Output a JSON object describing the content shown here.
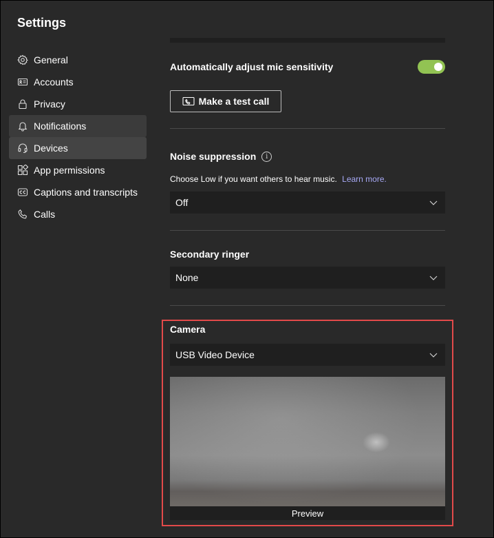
{
  "window": {
    "title": "Settings"
  },
  "sidebar": {
    "items": [
      {
        "label": "General",
        "icon": "gear-icon"
      },
      {
        "label": "Accounts",
        "icon": "id-card-icon"
      },
      {
        "label": "Privacy",
        "icon": "lock-icon"
      },
      {
        "label": "Notifications",
        "icon": "bell-icon",
        "state": "hover"
      },
      {
        "label": "Devices",
        "icon": "headset-icon",
        "state": "selected"
      },
      {
        "label": "App permissions",
        "icon": "apps-icon"
      },
      {
        "label": "Captions and transcripts",
        "icon": "cc-icon"
      },
      {
        "label": "Calls",
        "icon": "phone-icon"
      }
    ]
  },
  "devices": {
    "mic_sensitivity": {
      "label": "Automatically adjust mic sensitivity",
      "enabled": true
    },
    "test_call": {
      "label": "Make a test call"
    },
    "noise_suppression": {
      "label": "Noise suppression",
      "description": "Choose Low if you want others to hear music.",
      "learn_more": "Learn more.",
      "value": "Off"
    },
    "secondary_ringer": {
      "label": "Secondary ringer",
      "value": "None"
    },
    "camera": {
      "label": "Camera",
      "value": "USB Video Device",
      "preview_label": "Preview"
    }
  },
  "colors": {
    "toggle_on": "#92c353",
    "link": "#a7a9f5",
    "highlight_border": "#e34a4a",
    "background": "#292929",
    "input_background": "#1f1f1f"
  }
}
